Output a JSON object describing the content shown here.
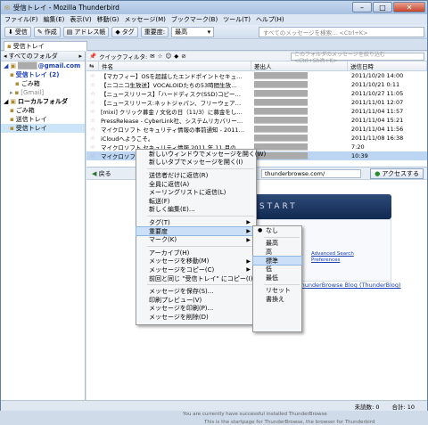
{
  "window": {
    "title": "受信トレイ - Mozilla Thunderbird",
    "min": "–",
    "max": "□",
    "close": "✕"
  },
  "menubar": [
    "ファイル(F)",
    "編集(E)",
    "表示(V)",
    "移動(G)",
    "メッセージ(M)",
    "ブックマーク(B)",
    "ツール(T)",
    "ヘルプ(H)"
  ],
  "toolbar": {
    "receive": "受信",
    "compose": "作成",
    "addressbook": "アドレス帳",
    "tag": "タグ",
    "priority_label": "重要度:",
    "priority_value": "最高",
    "search_placeholder": "すべてのメッセージを検索... <Ctrl+K>"
  },
  "tab": {
    "label": "受信トレイ",
    "close": "×"
  },
  "sidebar": {
    "header": "すべてのフォルダ",
    "items": [
      {
        "label": "@gmail.com",
        "style": "blue",
        "indent": 3,
        "icon": "▣"
      },
      {
        "label": "受信トレイ (2)",
        "style": "blue",
        "indent": 10,
        "icon": "▪"
      },
      {
        "label": "ごみ箱",
        "style": "",
        "indent": 16,
        "icon": "▪"
      },
      {
        "label": "[Gmail]",
        "style": "grey",
        "indent": 10,
        "icon": "▸"
      },
      {
        "label": "ローカルフォルダ",
        "style": "bold",
        "indent": 3,
        "icon": "▣"
      },
      {
        "label": "ごみ箱",
        "style": "",
        "indent": 10,
        "icon": "▪"
      },
      {
        "label": "送信トレイ",
        "style": "",
        "indent": 10,
        "icon": "▪"
      },
      {
        "label": "受信トレイ",
        "style": "",
        "indent": 10,
        "icon": "▪"
      }
    ]
  },
  "quickfilter": {
    "label": "クイックフィルタ:",
    "placeholder": "このフォルダのメッセージを絞り込む <Ctrl+Shift+K>"
  },
  "columns": {
    "subject": "件名",
    "sender": "差出人",
    "date": "送信日時"
  },
  "messages": [
    {
      "subject": "【マカフィー】OSを超越したエンドポイントセキュ…",
      "date": "2011/10/20 14:00"
    },
    {
      "subject": "【ニコニコ生放送】VOCALOIDたちの53時間生放…",
      "date": "2011/10/21 0:11"
    },
    {
      "subject": "【ニュースリリース】「ハードディスク(SSD)コピー…",
      "date": "2011/10/27 11:05"
    },
    {
      "subject": "【ニュースリリース:ネットジャパン、フリーウェア…",
      "date": "2011/11/01 12:07"
    },
    {
      "subject": "[mixi] クリック募金 / 文化の日（11/3）に募金をし…",
      "date": "2011/11/04 11:57"
    },
    {
      "subject": "PressRelease - CyberLink社、システムリカバリー…",
      "date": "2011/11/04 15:21"
    },
    {
      "subject": "マイクロソフト セキュリティ情報の事前通知 - 2011…",
      "date": "2011/11/04 11:56"
    },
    {
      "subject": "iCloudへようこそ。",
      "date": "2011/11/08 16:38"
    },
    {
      "subject": "マイクロソフト セキュリティ情報 2011 年 11 月の…",
      "date": "7:20"
    },
    {
      "subject": "マイクロソフト セキュリティ アドバイザリの更新通知…",
      "date": "10:39"
    }
  ],
  "msgpane": {
    "back": "戻る",
    "url": "thunderbrowse.com/",
    "accessible": "アクセスする",
    "banner": "E START",
    "adv1": "Advanced Search",
    "adv2": "Preferences",
    "links": "s Mirror   ThunderBrowse Blog (ThunderBlog)",
    "foot1": "You are currently have successful installed ThunderBrowse",
    "foot2": "This is the startpage for ThunderBrowse, the browser for Thunderbird"
  },
  "contextmenu": [
    "新しいウィンドウでメッセージを開く(W)",
    "新しいタブでメッセージを開く(I)",
    "—",
    "送信者だけに返信(R)",
    "全員に返信(A)",
    "メーリングリストに返信(L)",
    "転送(F)",
    "新しく編集(E)...",
    "—",
    "タグ(T)",
    "重要度",
    "マーク(K)",
    "—",
    "アーカイブ(H)",
    "メッセージを移動(M)",
    "メッセージをコピー(C)",
    "前回と同じ \"受信トレイ\" にコピー(I)",
    "—",
    "メッセージを保存(S)...",
    "印刷プレビュー(V)",
    "メッセージを印刷(P)...",
    "メッセージを削除(D)"
  ],
  "submenu": [
    "なし",
    "—",
    "最高",
    "高",
    "標準",
    "低",
    "最低",
    "—",
    "リセット",
    "書換え"
  ],
  "status": {
    "unread": "未読数: 0",
    "total": "合計: 10"
  },
  "colors": {
    "accent": "#1a3fb5",
    "selection": "#bcd5f3"
  }
}
